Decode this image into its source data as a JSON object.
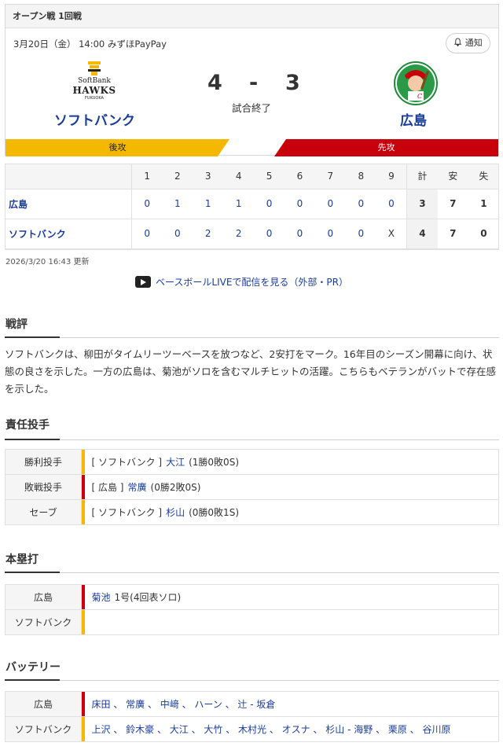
{
  "game": {
    "header": "オープン戦 1回戦",
    "datetime": "3月20日（金） 14:00 みずほPayPay",
    "notify_label": "通知",
    "home": {
      "name": "ソフトバンク",
      "score": "4",
      "side_label": "後攻"
    },
    "away": {
      "name": "広島",
      "score": "3",
      "side_label": "先攻"
    },
    "separator": "-",
    "status": "試合終了",
    "hawks_logo_text": [
      "SoftBank",
      "HAWKS",
      "FUKUOKA"
    ],
    "colors": {
      "home_accent": "#f5b800",
      "away_accent": "#c8000b",
      "link": "#1a3c98"
    }
  },
  "linescore": {
    "headers": [
      "1",
      "2",
      "3",
      "4",
      "5",
      "6",
      "7",
      "8",
      "9",
      "計",
      "安",
      "失"
    ],
    "rows": [
      {
        "team": "広島",
        "innings": [
          "0",
          "1",
          "1",
          "1",
          "0",
          "0",
          "0",
          "0",
          "0"
        ],
        "total": "3",
        "hits": "7",
        "errors": "1"
      },
      {
        "team": "ソフトバンク",
        "innings": [
          "0",
          "0",
          "2",
          "2",
          "0",
          "0",
          "0",
          "0",
          "X"
        ],
        "total": "4",
        "hits": "7",
        "errors": "0"
      }
    ]
  },
  "updated": "2026/3/20 16:43 更新",
  "live_link": "ベースボールLIVEで配信を見る（外部・PR）",
  "review": {
    "title": "戦評",
    "text": "ソフトバンクは、柳田がタイムリーツーベースを放つなど、2安打をマーク。16年目のシーズン開幕に向け、状態の良さを示した。一方の広島は、菊池がソロを含むマルチヒットの活躍。こちらもベテランがバットで存在感を示した。"
  },
  "pitchers": {
    "title": "責任投手",
    "rows": [
      {
        "label": "勝利投手",
        "team": "[ ソフトバンク ]",
        "name": "大江",
        "record": "(1勝0敗0S)",
        "side": "home"
      },
      {
        "label": "敗戦投手",
        "team": "[ 広島 ]",
        "name": "常廣",
        "record": "(0勝2敗0S)",
        "side": "away"
      },
      {
        "label": "セーブ",
        "team": "[ ソフトバンク ]",
        "name": "杉山",
        "record": "(0勝0敗1S)",
        "side": "home"
      }
    ]
  },
  "homeruns": {
    "title": "本塁打",
    "rows": [
      {
        "label": "広島",
        "name": "菊池",
        "detail": "1号(4回表ソロ)",
        "side": "away"
      },
      {
        "label": "ソフトバンク",
        "name": "",
        "detail": "",
        "side": "home"
      }
    ]
  },
  "battery": {
    "title": "バッテリー",
    "rows": [
      {
        "label": "広島",
        "text": "床田 、 常廣 、 中﨑 、 ハーン 、 辻 - 坂倉",
        "side": "away"
      },
      {
        "label": "ソフトバンク",
        "text": "上沢 、 鈴木豪 、 大江 、 大竹 、 木村光 、 オスナ 、 杉山 - 海野 、 栗原 、 谷川原",
        "side": "home"
      }
    ]
  }
}
